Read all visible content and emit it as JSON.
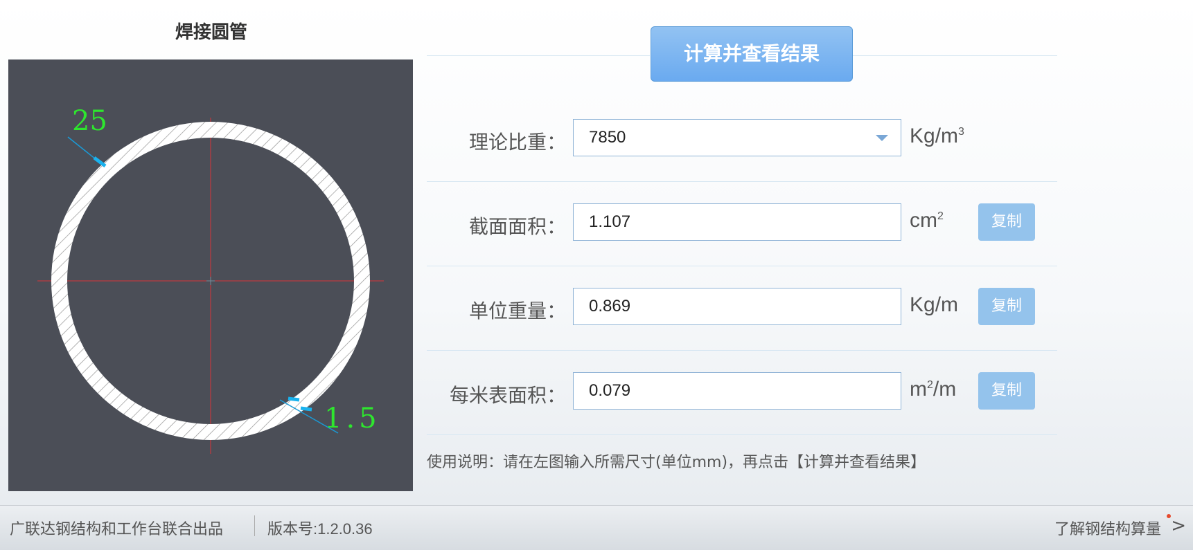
{
  "drawing": {
    "title": "焊接圆管",
    "diameter_label": "25",
    "thickness_label": "1.5"
  },
  "toolbar": {
    "calculate_label": "计算并查看结果"
  },
  "fields": {
    "density": {
      "label": "理论比重：",
      "value": "7850",
      "unit_base": "Kg/m",
      "unit_sup": "3"
    },
    "area": {
      "label": "截面面积：",
      "value": "1.107",
      "unit_base": "cm",
      "unit_sup": "2",
      "copy_label": "复制"
    },
    "weight": {
      "label": "单位重量：",
      "value": "0.869",
      "unit_base": "Kg/m",
      "copy_label": "复制"
    },
    "surface": {
      "label": "每米表面积：",
      "value": "0.079",
      "unit_base": "m",
      "unit_sup": "2",
      "unit_tail": "/m",
      "copy_label": "复制"
    }
  },
  "usage_note": "使用说明：请在左图输入所需尺寸(单位mm)，再点击【计算并查看结果】",
  "footer": {
    "credits": "广联达钢结构和工作台联合出品",
    "version": "版本号:1.2.0.36",
    "learn_more": "了解钢结构算量"
  },
  "colors": {
    "canvas_bg": "#4b4e57",
    "dimension_text": "#2ee62e",
    "crosshair": "#d9343a",
    "button_blue": "#7ab4f0"
  }
}
